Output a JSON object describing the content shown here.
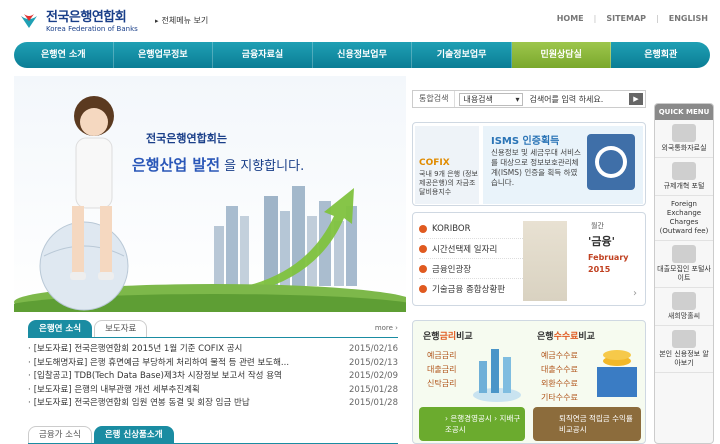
{
  "header": {
    "logo_ko": "전국은행연합회",
    "logo_en": "Korea Federation of Banks",
    "sitemap_link": "전체메뉴 보기",
    "util": [
      "HOME",
      "SITEMAP",
      "ENGLISH"
    ]
  },
  "nav": [
    "은행연 소개",
    "은행업무정보",
    "금융자료실",
    "신용정보업무",
    "기술정보업무",
    "민원상담실",
    "은행회관"
  ],
  "hero": {
    "title": "전국은행연합회는",
    "sub_em": "은행산업 발전",
    "sub_rest": "을 지향합니다."
  },
  "search": {
    "label": "통합검색",
    "select": "내용검색",
    "placeholder": "검색어를 입력 하세요.",
    "button": "▶"
  },
  "cofix": {
    "title": "COFIX",
    "desc": "국내 9개 은행 (정보제공은행)의 자금조달비용지수"
  },
  "isms": {
    "title": "ISMS 인증획득",
    "desc": "신용정보 및 세금우대 서비스를 대상으로 정보보호관리체계(ISMS) 인증을 획득 하였습니다."
  },
  "links": [
    "KORIBOR",
    "시간선택제 일자리",
    "금융인광장",
    "기술금융 종합상황판"
  ],
  "magazine": {
    "month": "월간",
    "name": "'금융'",
    "en": "February",
    "year": "2015"
  },
  "quick": {
    "title": "QUICK MENU",
    "items": [
      "외국통화자료실",
      "규제개혁 포털",
      "Foreign Exchange Charges (Outward fee)",
      "대출모집인 포털사이트",
      "새희망홀씨",
      "본인 신용정보 알아보기"
    ]
  },
  "news": {
    "tabs": [
      "은행연 소식",
      "보도자료"
    ],
    "more": "more ›",
    "rows": [
      {
        "t": "[보도자료] 전국은행연합회 2015년 1월 기준 COFIX 공시",
        "d": "2015/02/16"
      },
      {
        "t": "[보도해명자료] 은행 휴면예금 부당하게 처리하여 물적 등 관련 보도해...",
        "d": "2015/02/13"
      },
      {
        "t": "[입찰공고] TDB(Tech Data Base)제3차 시장정보 보고서 작성 용역",
        "d": "2015/02/09"
      },
      {
        "t": "[보도자료] 은행의 내부관행 개선 세부추진계획",
        "d": "2015/01/28"
      },
      {
        "t": "[보도자료] 전국은행연합회 임원 연봉 동결 및 회장 임금 반납",
        "d": "2015/01/28"
      }
    ]
  },
  "news2": {
    "tabs": [
      "금융가 소식",
      "은행 신상품소개"
    ]
  },
  "compare": {
    "rate_pre": "은행",
    "rate_em": "금리",
    "rate_post": "비교",
    "rate_items": [
      "예금금리",
      "대출금리",
      "신탁금리"
    ],
    "fee_pre": "은행",
    "fee_em": "수수료",
    "fee_post": "비교",
    "fee_items": [
      "예금수수료",
      "대출수수료",
      "외환수수료",
      "기타수수료"
    ],
    "btn1": "› 은행경영공시 › 지배구조공시",
    "btn2": "퇴직연금 적립금 수익률 비교공시"
  }
}
